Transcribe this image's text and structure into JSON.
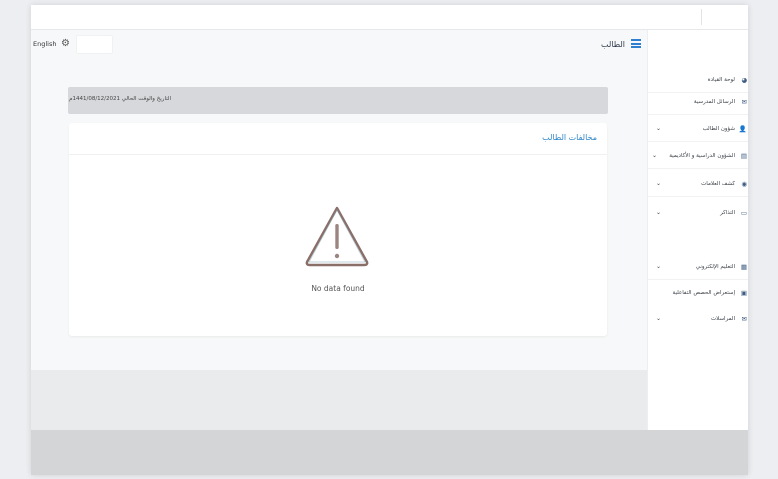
{
  "header": {
    "language_label": "English",
    "settings_icon": "gear-icon",
    "page_title": "الطالب",
    "menu_icon": "hamburger-icon",
    "accent_color": "#2f7fd1"
  },
  "date_bar": {
    "text": "التاريخ والوقت الحالي 1441/08/12/2021م"
  },
  "card": {
    "title": "مخالفات الطالب",
    "empty_icon": "warning-triangle-icon",
    "empty_text": "No data found"
  },
  "sidebar": {
    "items": [
      {
        "label": "لوحة القيادة",
        "icon": "dashboard-icon",
        "has_chevron": false
      },
      {
        "label": "الرسائل المدرسية",
        "icon": "message-icon",
        "has_chevron": false
      },
      {
        "label": "شؤون الطالب",
        "icon": "student-icon",
        "has_chevron": true
      },
      {
        "label": "الشؤون الدراسية و الأكاديمية",
        "icon": "book-icon",
        "has_chevron": true
      },
      {
        "label": "كشف العلامات",
        "icon": "grades-icon",
        "has_chevron": true
      },
      {
        "label": "التذاكر",
        "icon": "ticket-icon",
        "has_chevron": true
      },
      {
        "label": "التعليم الإلكتروني",
        "icon": "elearning-icon",
        "has_chevron": true
      },
      {
        "label": "إستعراض الحصص التفاعلية",
        "icon": "video-icon",
        "has_chevron": false
      },
      {
        "label": "المراسلات",
        "icon": "mail-icon",
        "has_chevron": true
      }
    ]
  }
}
